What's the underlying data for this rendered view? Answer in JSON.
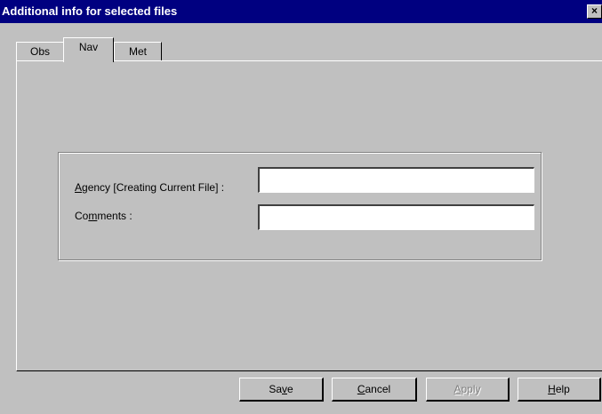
{
  "window": {
    "title": "Additional info for selected files",
    "close_glyph": "×"
  },
  "tabs": [
    {
      "label": "Obs",
      "selected": false
    },
    {
      "label": "Nav",
      "selected": true
    },
    {
      "label": "Met",
      "selected": false
    }
  ],
  "form": {
    "agency": {
      "label_mnemonic": "A",
      "label_rest": "gency [Creating Current File]  :",
      "value": ""
    },
    "comments": {
      "label_pre": "Co",
      "label_mnemonic": "m",
      "label_rest": "ments :",
      "value": ""
    }
  },
  "buttons": {
    "save": {
      "pre": "Sa",
      "mnemonic": "v",
      "post": "e"
    },
    "cancel": {
      "pre": "",
      "mnemonic": "C",
      "post": "ancel"
    },
    "apply": {
      "pre": "",
      "mnemonic": "A",
      "post": "pply",
      "enabled": false
    },
    "help": {
      "pre": "",
      "mnemonic": "H",
      "post": "elp"
    }
  },
  "colors": {
    "titlebar": "#000080",
    "face": "#c0c0c0",
    "disabled_text": "#808080"
  }
}
